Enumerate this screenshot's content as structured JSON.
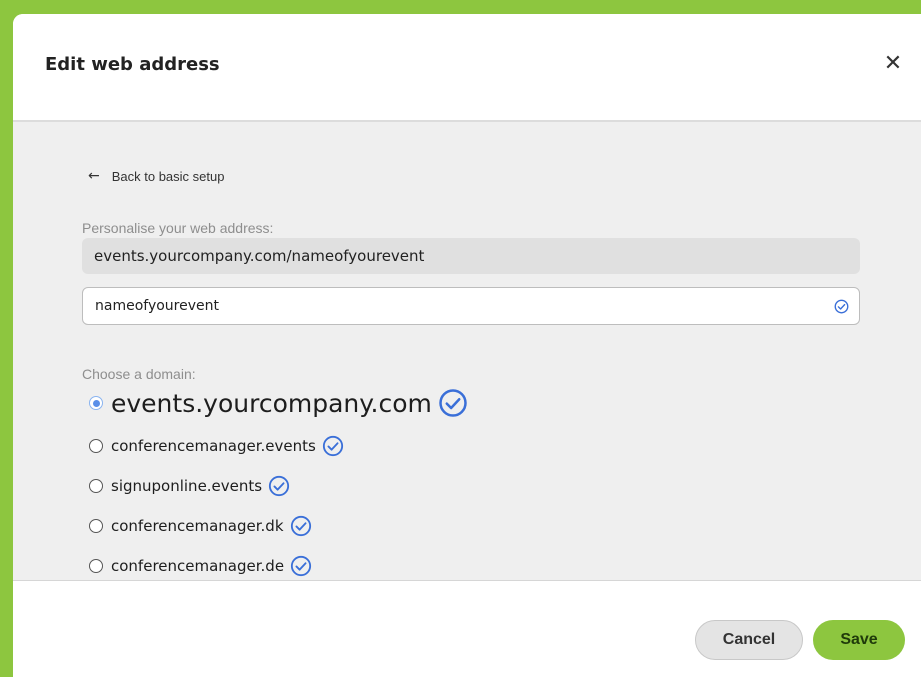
{
  "dialog": {
    "title": "Edit web address",
    "close_symbol": "✕"
  },
  "body": {
    "back_link": {
      "arrow": "←",
      "label": "Back to basic setup"
    },
    "personalise_label": "Personalise your web address:",
    "preview_url": "events.yourcompany.com/nameofyourevent",
    "slug_input": {
      "value": "nameofyourevent",
      "placeholder": ""
    },
    "domain_label": "Choose a domain:",
    "domains": [
      {
        "label": "events.yourcompany.com",
        "selected": true
      },
      {
        "label": "conferencemanager.events",
        "selected": false
      },
      {
        "label": "signuponline.events",
        "selected": false
      },
      {
        "label": "conferencemanager.dk",
        "selected": false
      },
      {
        "label": "conferencemanager.de",
        "selected": false
      }
    ]
  },
  "footer": {
    "cancel_label": "Cancel",
    "save_label": "Save"
  },
  "colors": {
    "brand_green": "#8dc63f",
    "check_blue": "#3a6fd8"
  },
  "icons": [
    "close-icon",
    "back-arrow-icon",
    "check-circle-icon"
  ]
}
